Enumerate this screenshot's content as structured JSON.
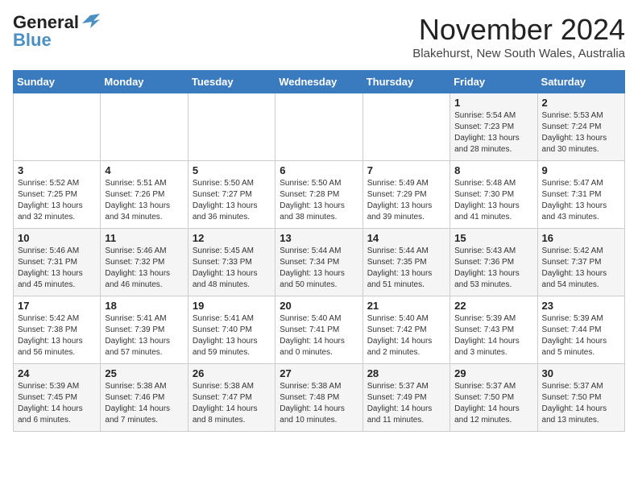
{
  "logo": {
    "line1": "General",
    "line2": "Blue"
  },
  "title": "November 2024",
  "subtitle": "Blakehurst, New South Wales, Australia",
  "days_of_week": [
    "Sunday",
    "Monday",
    "Tuesday",
    "Wednesday",
    "Thursday",
    "Friday",
    "Saturday"
  ],
  "weeks": [
    [
      {
        "day": "",
        "info": ""
      },
      {
        "day": "",
        "info": ""
      },
      {
        "day": "",
        "info": ""
      },
      {
        "day": "",
        "info": ""
      },
      {
        "day": "",
        "info": ""
      },
      {
        "day": "1",
        "info": "Sunrise: 5:54 AM\nSunset: 7:23 PM\nDaylight: 13 hours\nand 28 minutes."
      },
      {
        "day": "2",
        "info": "Sunrise: 5:53 AM\nSunset: 7:24 PM\nDaylight: 13 hours\nand 30 minutes."
      }
    ],
    [
      {
        "day": "3",
        "info": "Sunrise: 5:52 AM\nSunset: 7:25 PM\nDaylight: 13 hours\nand 32 minutes."
      },
      {
        "day": "4",
        "info": "Sunrise: 5:51 AM\nSunset: 7:26 PM\nDaylight: 13 hours\nand 34 minutes."
      },
      {
        "day": "5",
        "info": "Sunrise: 5:50 AM\nSunset: 7:27 PM\nDaylight: 13 hours\nand 36 minutes."
      },
      {
        "day": "6",
        "info": "Sunrise: 5:50 AM\nSunset: 7:28 PM\nDaylight: 13 hours\nand 38 minutes."
      },
      {
        "day": "7",
        "info": "Sunrise: 5:49 AM\nSunset: 7:29 PM\nDaylight: 13 hours\nand 39 minutes."
      },
      {
        "day": "8",
        "info": "Sunrise: 5:48 AM\nSunset: 7:30 PM\nDaylight: 13 hours\nand 41 minutes."
      },
      {
        "day": "9",
        "info": "Sunrise: 5:47 AM\nSunset: 7:31 PM\nDaylight: 13 hours\nand 43 minutes."
      }
    ],
    [
      {
        "day": "10",
        "info": "Sunrise: 5:46 AM\nSunset: 7:31 PM\nDaylight: 13 hours\nand 45 minutes."
      },
      {
        "day": "11",
        "info": "Sunrise: 5:46 AM\nSunset: 7:32 PM\nDaylight: 13 hours\nand 46 minutes."
      },
      {
        "day": "12",
        "info": "Sunrise: 5:45 AM\nSunset: 7:33 PM\nDaylight: 13 hours\nand 48 minutes."
      },
      {
        "day": "13",
        "info": "Sunrise: 5:44 AM\nSunset: 7:34 PM\nDaylight: 13 hours\nand 50 minutes."
      },
      {
        "day": "14",
        "info": "Sunrise: 5:44 AM\nSunset: 7:35 PM\nDaylight: 13 hours\nand 51 minutes."
      },
      {
        "day": "15",
        "info": "Sunrise: 5:43 AM\nSunset: 7:36 PM\nDaylight: 13 hours\nand 53 minutes."
      },
      {
        "day": "16",
        "info": "Sunrise: 5:42 AM\nSunset: 7:37 PM\nDaylight: 13 hours\nand 54 minutes."
      }
    ],
    [
      {
        "day": "17",
        "info": "Sunrise: 5:42 AM\nSunset: 7:38 PM\nDaylight: 13 hours\nand 56 minutes."
      },
      {
        "day": "18",
        "info": "Sunrise: 5:41 AM\nSunset: 7:39 PM\nDaylight: 13 hours\nand 57 minutes."
      },
      {
        "day": "19",
        "info": "Sunrise: 5:41 AM\nSunset: 7:40 PM\nDaylight: 13 hours\nand 59 minutes."
      },
      {
        "day": "20",
        "info": "Sunrise: 5:40 AM\nSunset: 7:41 PM\nDaylight: 14 hours\nand 0 minutes."
      },
      {
        "day": "21",
        "info": "Sunrise: 5:40 AM\nSunset: 7:42 PM\nDaylight: 14 hours\nand 2 minutes."
      },
      {
        "day": "22",
        "info": "Sunrise: 5:39 AM\nSunset: 7:43 PM\nDaylight: 14 hours\nand 3 minutes."
      },
      {
        "day": "23",
        "info": "Sunrise: 5:39 AM\nSunset: 7:44 PM\nDaylight: 14 hours\nand 5 minutes."
      }
    ],
    [
      {
        "day": "24",
        "info": "Sunrise: 5:39 AM\nSunset: 7:45 PM\nDaylight: 14 hours\nand 6 minutes."
      },
      {
        "day": "25",
        "info": "Sunrise: 5:38 AM\nSunset: 7:46 PM\nDaylight: 14 hours\nand 7 minutes."
      },
      {
        "day": "26",
        "info": "Sunrise: 5:38 AM\nSunset: 7:47 PM\nDaylight: 14 hours\nand 8 minutes."
      },
      {
        "day": "27",
        "info": "Sunrise: 5:38 AM\nSunset: 7:48 PM\nDaylight: 14 hours\nand 10 minutes."
      },
      {
        "day": "28",
        "info": "Sunrise: 5:37 AM\nSunset: 7:49 PM\nDaylight: 14 hours\nand 11 minutes."
      },
      {
        "day": "29",
        "info": "Sunrise: 5:37 AM\nSunset: 7:50 PM\nDaylight: 14 hours\nand 12 minutes."
      },
      {
        "day": "30",
        "info": "Sunrise: 5:37 AM\nSunset: 7:50 PM\nDaylight: 14 hours\nand 13 minutes."
      }
    ]
  ]
}
